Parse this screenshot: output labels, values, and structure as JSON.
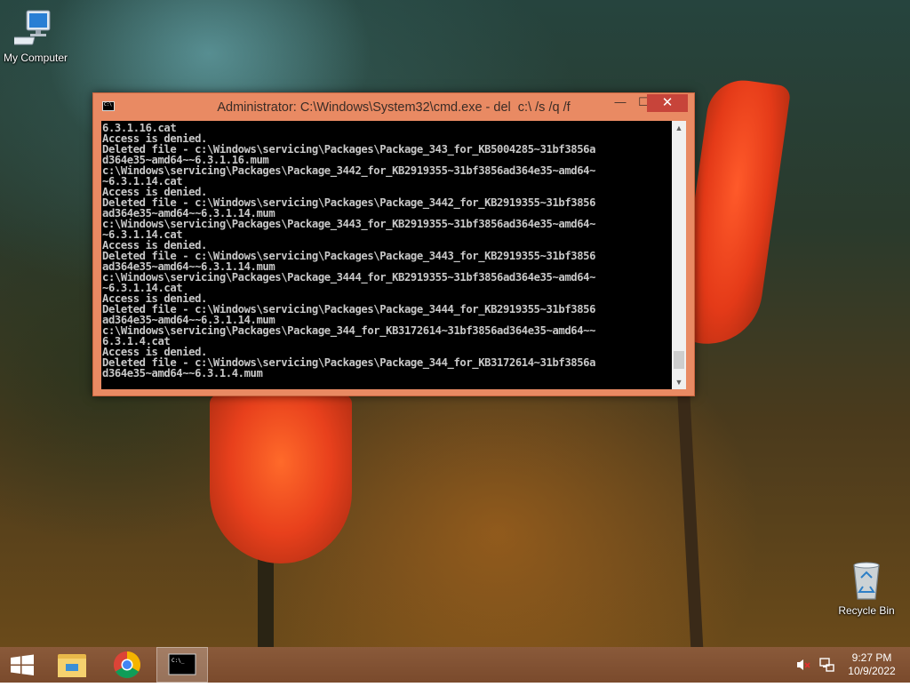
{
  "desktop": {
    "icons": [
      {
        "label": "My Computer",
        "icon": "computer-icon"
      },
      {
        "label": "Recycle Bin",
        "icon": "recycle-bin-icon"
      }
    ]
  },
  "cmd_window": {
    "title": "Administrator: C:\\Windows\\System32\\cmd.exe - del  c:\\ /s /q /f",
    "controls": {
      "minimize": "—",
      "maximize": "☐",
      "close": "✕"
    },
    "output_lines": [
      "6.3.1.16.cat",
      "Access is denied.",
      "Deleted file - c:\\Windows\\servicing\\Packages\\Package_343_for_KB5004285~31bf3856a",
      "d364e35~amd64~~6.3.1.16.mum",
      "c:\\Windows\\servicing\\Packages\\Package_3442_for_KB2919355~31bf3856ad364e35~amd64~",
      "~6.3.1.14.cat",
      "Access is denied.",
      "Deleted file - c:\\Windows\\servicing\\Packages\\Package_3442_for_KB2919355~31bf3856",
      "ad364e35~amd64~~6.3.1.14.mum",
      "c:\\Windows\\servicing\\Packages\\Package_3443_for_KB2919355~31bf3856ad364e35~amd64~",
      "~6.3.1.14.cat",
      "Access is denied.",
      "Deleted file - c:\\Windows\\servicing\\Packages\\Package_3443_for_KB2919355~31bf3856",
      "ad364e35~amd64~~6.3.1.14.mum",
      "c:\\Windows\\servicing\\Packages\\Package_3444_for_KB2919355~31bf3856ad364e35~amd64~",
      "~6.3.1.14.cat",
      "Access is denied.",
      "Deleted file - c:\\Windows\\servicing\\Packages\\Package_3444_for_KB2919355~31bf3856",
      "ad364e35~amd64~~6.3.1.14.mum",
      "c:\\Windows\\servicing\\Packages\\Package_344_for_KB3172614~31bf3856ad364e35~amd64~~",
      "6.3.1.4.cat",
      "Access is denied.",
      "Deleted file - c:\\Windows\\servicing\\Packages\\Package_344_for_KB3172614~31bf3856a",
      "d364e35~amd64~~6.3.1.4.mum"
    ],
    "scroll_position": 0.97
  },
  "taskbar": {
    "items": [
      {
        "name": "start-button",
        "icon": "windows-logo-icon"
      },
      {
        "name": "file-explorer",
        "icon": "folder-icon"
      },
      {
        "name": "chrome",
        "icon": "chrome-icon"
      },
      {
        "name": "command-prompt",
        "icon": "cmd-icon",
        "active": true
      }
    ],
    "tray": {
      "volume": "muted",
      "network": "network-icon",
      "time": "9:27 PM",
      "date": "10/9/2022"
    }
  },
  "colors": {
    "window_frame": "#e98a63",
    "close_button": "#c7443a",
    "console_bg": "#000000",
    "console_text": "#c8c8c8"
  }
}
